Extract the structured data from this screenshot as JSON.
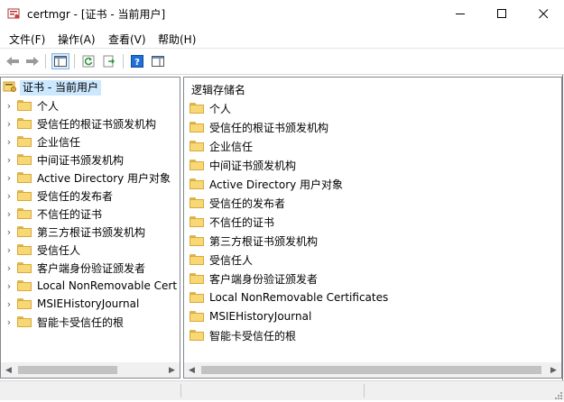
{
  "window": {
    "title": "certmgr - [证书 - 当前用户]"
  },
  "menu": [
    "文件(F)",
    "操作(A)",
    "查看(V)",
    "帮助(H)"
  ],
  "toolbar": {
    "buttons": [
      "back-arrow-icon",
      "forward-arrow-icon",
      "show-hide-tree-icon",
      "refresh-icon",
      "export-list-icon",
      "help-icon",
      "action-pane-icon"
    ]
  },
  "tree": {
    "root": "证书 - 当前用户",
    "items": [
      "个人",
      "受信任的根证书颁发机构",
      "企业信任",
      "中间证书颁发机构",
      "Active Directory 用户对象",
      "受信任的发布者",
      "不信任的证书",
      "第三方根证书颁发机构",
      "受信任人",
      "客户端身份验证颁发者",
      "Local NonRemovable Cert",
      "MSIEHistoryJournal",
      "智能卡受信任的根"
    ]
  },
  "list": {
    "column_header": "逻辑存储名",
    "items": [
      "个人",
      "受信任的根证书颁发机构",
      "企业信任",
      "中间证书颁发机构",
      "Active Directory 用户对象",
      "受信任的发布者",
      "不信任的证书",
      "第三方根证书颁发机构",
      "受信任人",
      "客户端身份验证颁发者",
      "Local NonRemovable Certificates",
      "MSIEHistoryJournal",
      "智能卡受信任的根"
    ]
  },
  "colors": {
    "selection": "#cce8ff",
    "folder": "#f8d775",
    "accent": "#1e6fd9"
  }
}
